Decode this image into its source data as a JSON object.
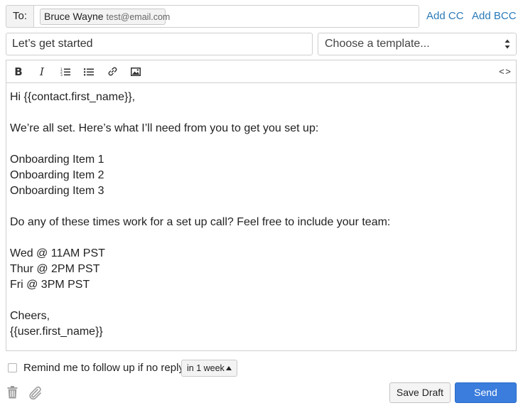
{
  "to": {
    "label": "To:",
    "recipient_name": "Bruce Wayne",
    "recipient_email": "test@email.com",
    "add_cc": "Add CC",
    "add_bcc": "Add BCC"
  },
  "subject": {
    "value": "Let’s get started"
  },
  "template": {
    "selected": "Choose a template..."
  },
  "toolbar": {
    "bold": "B",
    "italic": "I",
    "icons": [
      "bold-icon",
      "italic-icon",
      "numbered-list-icon",
      "bulleted-list-icon",
      "link-icon",
      "image-icon",
      "code-view-icon"
    ],
    "code_label": "< >"
  },
  "body": {
    "lines": [
      "Hi {{contact.first_name}},",
      "",
      "We’re all set. Here’s what I’ll need from you to get you set up:",
      "",
      "Onboarding Item 1",
      "Onboarding Item 2",
      "Onboarding Item 3",
      "",
      "Do any of these times work for a set up call? Feel free to include your team:",
      "",
      "Wed @ 11AM PST",
      "Thur @ 2PM PST",
      "Fri @ 3PM PST",
      "",
      "Cheers,",
      "{{user.first_name}}"
    ]
  },
  "followup": {
    "label": "Remind me to follow up if no reply",
    "checked": false,
    "interval": "in 1 week"
  },
  "footer": {
    "save_draft": "Save Draft",
    "send": "Send",
    "icons": [
      "trash-icon",
      "paperclip-icon"
    ]
  },
  "colors": {
    "link": "#2a7ab8",
    "primary": "#3b7ddd",
    "border": "#cfcfcf"
  }
}
